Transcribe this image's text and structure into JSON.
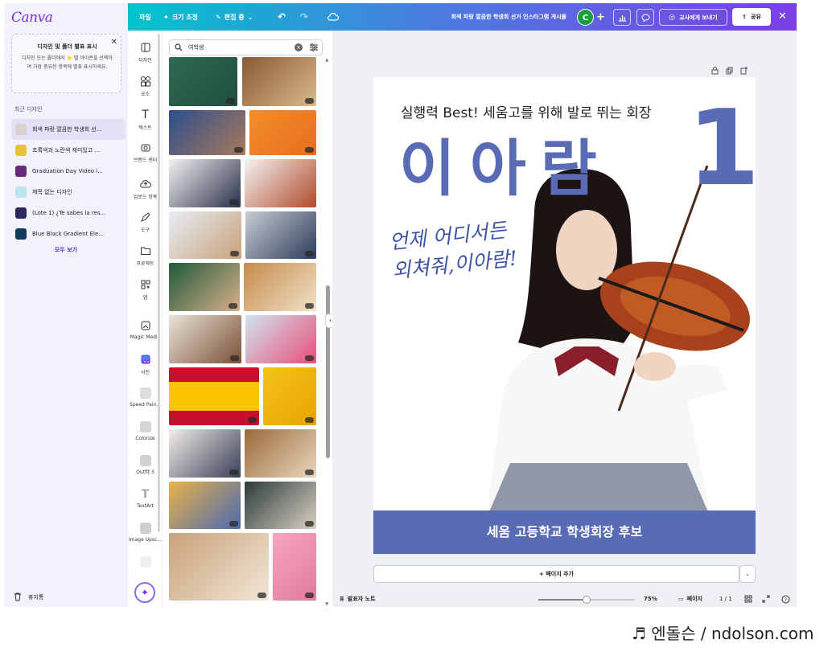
{
  "app": {
    "logo": "Canva",
    "colors": {
      "brand": "#7d2ae8",
      "poster_blue": "#5a6bb5",
      "handwriting": "#3e52a8"
    }
  },
  "home_sidebar": {
    "tip": {
      "title": "디자인 및 폴더 별표 표시",
      "body": "디자인 또는 폴더에서 ⭐ 별 아이콘을 선택하여 가장 중요한 항목에 별표 표시하세요."
    },
    "recent_heading": "최근 디자인",
    "recent_items": [
      {
        "label": "회색 파랑 깔끔한 학생회 선...",
        "color": "#d9cfcf"
      },
      {
        "label": "초록색과 노란색 재미있고 ...",
        "color": "#e8c33a"
      },
      {
        "label": "Graduation Day Video i...",
        "color": "#6a2a7a"
      },
      {
        "label": "제목 없는 디자인",
        "color": "#bfe3f0"
      },
      {
        "label": "(Lote 1) ¿Te sabes la res...",
        "color": "#2a2a5a"
      },
      {
        "label": "Blue Black Gradient Ele...",
        "color": "#123a5a"
      }
    ],
    "see_all": "모두 보기",
    "trash": "휴지통"
  },
  "topbar": {
    "file": "파일",
    "resize": "크기 조정",
    "editing": "편집 중",
    "doc_title": "회색 파랑 깔끔한 학생회 선거 인스타그램 게시물",
    "avatar_initial": "C",
    "send_to_teacher": "교사에게 보내기",
    "share": "공유"
  },
  "rail": {
    "items": [
      {
        "label": "디자인",
        "icon": "layout-icon"
      },
      {
        "label": "요소",
        "icon": "elements-icon"
      },
      {
        "label": "텍스트",
        "icon": "text-icon"
      },
      {
        "label": "브랜드 센터",
        "icon": "brand-icon"
      },
      {
        "label": "업로드 항목",
        "icon": "upload-icon"
      },
      {
        "label": "도구",
        "icon": "pen-icon"
      },
      {
        "label": "프로젝트",
        "icon": "folder-icon"
      },
      {
        "label": "앱",
        "icon": "apps-icon"
      },
      {
        "label": "Magic Media",
        "icon": "magic-media-icon"
      },
      {
        "label": "사진",
        "icon": "photo-icon"
      },
      {
        "label": "Speed Pain...",
        "icon": "speed-paint-icon"
      },
      {
        "label": "Colorize",
        "icon": "colorize-icon"
      },
      {
        "label": "Outfit 3",
        "icon": "outfit-icon"
      },
      {
        "label": "TextArt",
        "icon": "textart-icon"
      },
      {
        "label": "Image Upsc...",
        "icon": "upscale-icon"
      }
    ]
  },
  "panel": {
    "search_value": "여학생"
  },
  "poster": {
    "slogan": "실행력 Best! 세움고를 위해 발로 뛰는 회장",
    "name": "이아람",
    "number": "1",
    "handwriting_line1": "언제 어디서든",
    "handwriting_line2": "외쳐줘,이아람!",
    "footer": "세움 고등학교 학생회장 후보"
  },
  "canvas": {
    "add_page": "+ 페이지 추가"
  },
  "bottombar": {
    "notes": "발표자 노트",
    "zoom": "75%",
    "zoom_fraction": 0.5,
    "pages_label": "페이지",
    "page_count": "1 / 1"
  },
  "watermark": "♬ 엔돌슨 / ndolson.com"
}
